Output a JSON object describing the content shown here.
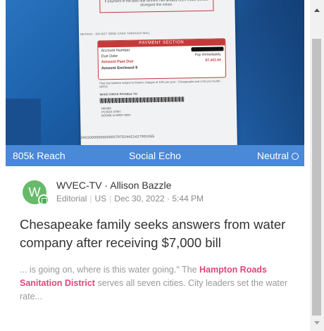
{
  "media": {
    "bill_header": "If payment of the past due amount has already been made, please disregard this notice.",
    "tear_line": "DETACH - DO NOT SEND CASH THROUGH MAIL",
    "payment_section": {
      "title": "PAYMENT SECTION",
      "account_number_label": "Account Number",
      "due_date_label": "Due Date",
      "due_date_value": "Pay Immediately",
      "amount_past_due_label": "Amount Past Due",
      "amount_past_due_value": "$7,441.64",
      "amount_enclosed_label": "Amount Enclosed $"
    },
    "finance_note": "Past due balance subject to finance charges of 12% per year - Chesapeake and 1.5% per month - HRSD",
    "payable_to": "MAKE CHECK PAYABLE TO:",
    "address": [
      "HRUBS",
      "PO BOX 37097",
      "BOONE IA 50037-0097"
    ],
    "scan_line": "3401000000000000797524421427991055"
  },
  "stats": {
    "reach": "805k Reach",
    "source_type": "Social Echo",
    "sentiment": "Neutral"
  },
  "article": {
    "avatar_letter": "W",
    "outlet": "WVEC-TV",
    "author": "Allison Bazzle",
    "category": "Editorial",
    "region": "US",
    "timestamp": "Dec 30, 2022 · 5:44 PM",
    "headline": "Chesapeake family seeks answers from water company after receiving $7,000 bill",
    "snippet_before": "... is going on, where is this water going.\" The ",
    "snippet_highlight": "Hampton Roads Sanitation District",
    "snippet_after": " serves all seven cities. City leaders set the water rate..."
  },
  "icons": {
    "sentiment_icon": "circle-outline-icon",
    "avatar_badge_icon": "document-icon",
    "scroll_up": "arrow-up-icon",
    "scroll_down": "arrow-down-icon"
  },
  "colors": {
    "stats_bar": "#4a88d8",
    "avatar": "#66bb6a",
    "highlight": "#e0457b",
    "bill_red": "#c43a3a"
  }
}
